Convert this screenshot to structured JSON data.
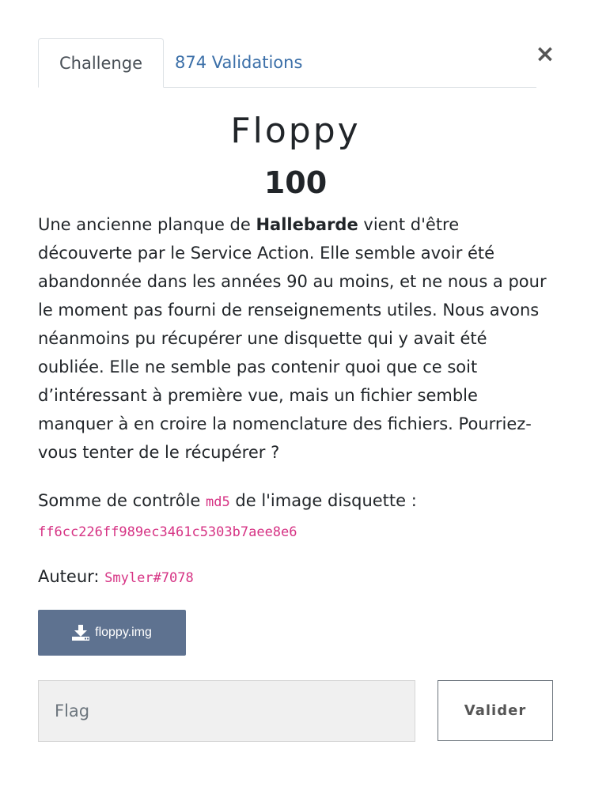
{
  "close": {
    "symbol": "×"
  },
  "tabs": [
    {
      "label": "Challenge",
      "active": true
    },
    {
      "label": "874 Validations",
      "active": false
    }
  ],
  "challenge": {
    "name": "Floppy",
    "points": "100",
    "description": {
      "prefix": "Une ancienne planque de ",
      "bold": "Hallebarde",
      "suffix": " vient d'être découverte par le Service Action. Elle semble avoir été abandonnée dans les années 90 au moins, et ne nous a pour le moment pas fourni de renseignements utiles. Nous avons néanmoins pu récupérer une disquette qui y avait été oubliée. Elle ne semble pas contenir quoi que ce soit d’intéressant à première vue, mais un fichier semble manquer à en croire la nomenclature des fichiers. Pourriez-vous tenter de le récupérer ?"
    },
    "checksum": {
      "prefix": "Somme de contrôle ",
      "algo": "md5",
      "suffix": " de l'image disquette :",
      "hash": "ff6cc226ff989ec3461c5303b7aee8e6"
    },
    "author": {
      "label": "Auteur:",
      "name": "Smyler#7078"
    },
    "download": {
      "icon": "download-icon",
      "label": "floppy.img"
    }
  },
  "form": {
    "flag_placeholder": "Flag",
    "flag_value": "",
    "submit_label": "Valider"
  },
  "colors": {
    "link": "#3b6fa8",
    "code": "#d63384",
    "download_bg": "#5e7290"
  }
}
